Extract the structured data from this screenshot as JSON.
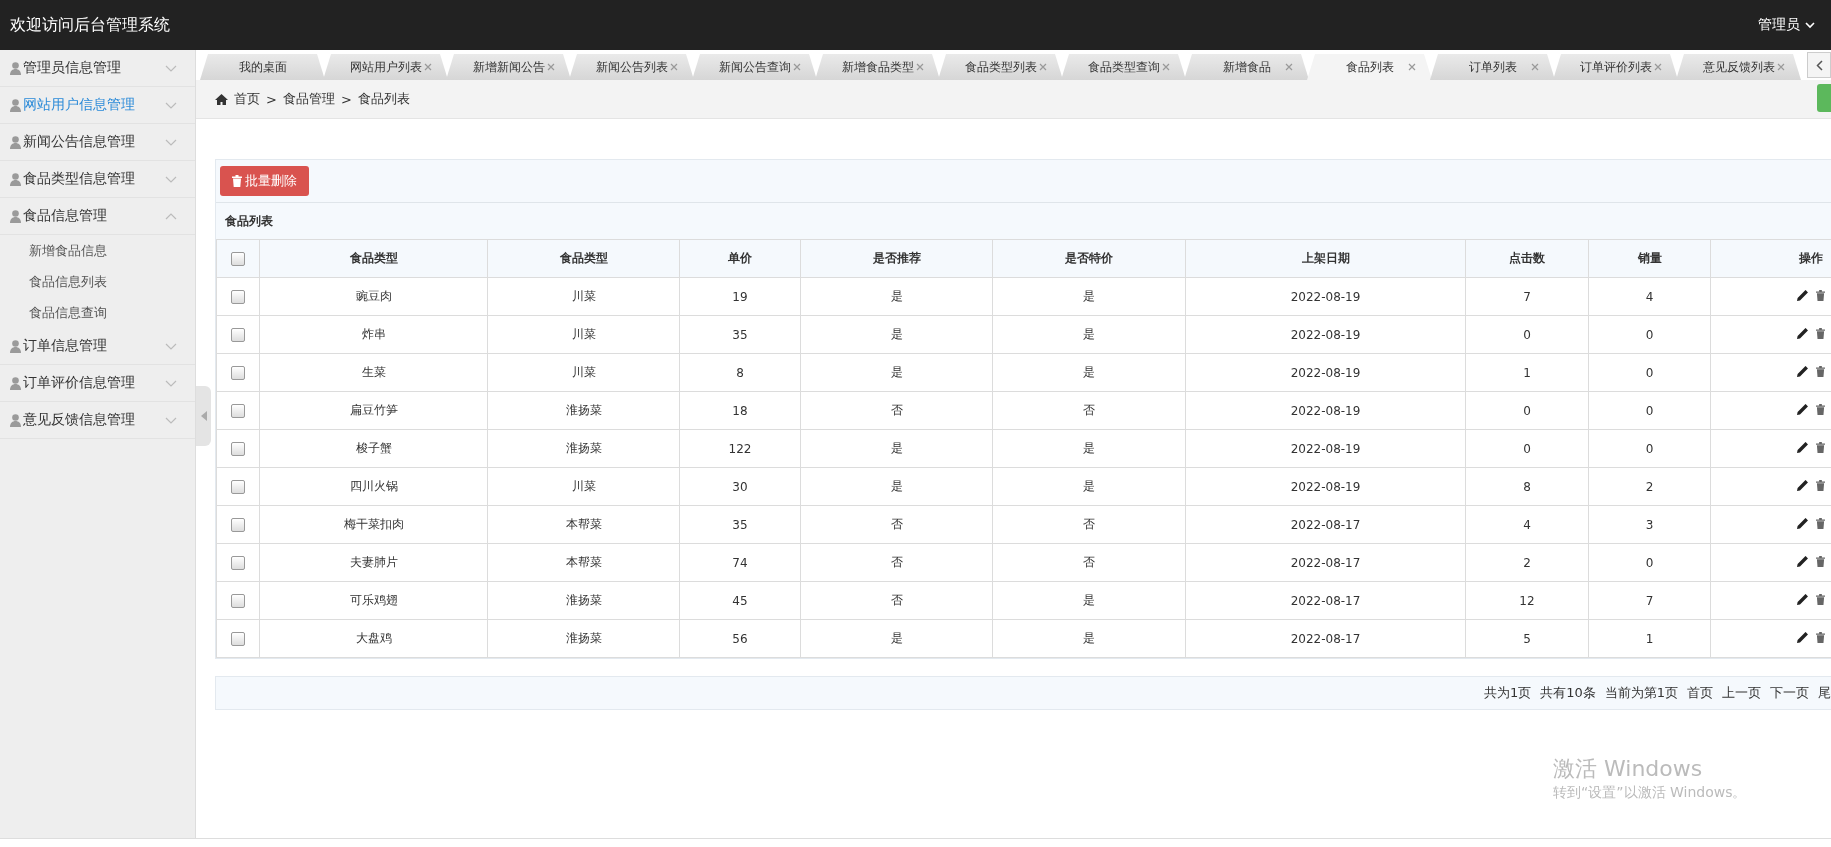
{
  "header": {
    "title": "欢迎访问后台管理系统",
    "user": "管理员"
  },
  "sidebar": {
    "items": [
      {
        "label": "管理员信息管理",
        "selected": false,
        "expanded": false
      },
      {
        "label": "网站用户信息管理",
        "selected": true,
        "expanded": false
      },
      {
        "label": "新闻公告信息管理",
        "selected": false,
        "expanded": false
      },
      {
        "label": "食品类型信息管理",
        "selected": false,
        "expanded": false
      },
      {
        "label": "食品信息管理",
        "selected": false,
        "expanded": true,
        "children": [
          {
            "label": "新增食品信息"
          },
          {
            "label": "食品信息列表"
          },
          {
            "label": "食品信息查询"
          }
        ]
      },
      {
        "label": "订单信息管理",
        "selected": false,
        "expanded": false
      },
      {
        "label": "订单评价信息管理",
        "selected": false,
        "expanded": false
      },
      {
        "label": "意见反馈信息管理",
        "selected": false,
        "expanded": false
      }
    ]
  },
  "tabs": [
    {
      "label": "我的桌面",
      "selected": false,
      "closable": false
    },
    {
      "label": "网站用户列表",
      "selected": false,
      "closable": true
    },
    {
      "label": "新增新闻公告",
      "selected": false,
      "closable": true
    },
    {
      "label": "新闻公告列表",
      "selected": false,
      "closable": true
    },
    {
      "label": "新闻公告查询",
      "selected": false,
      "closable": true
    },
    {
      "label": "新增食品类型",
      "selected": false,
      "closable": true
    },
    {
      "label": "食品类型列表",
      "selected": false,
      "closable": true
    },
    {
      "label": "食品类型查询",
      "selected": false,
      "closable": true
    },
    {
      "label": "新增食品",
      "selected": false,
      "closable": true
    },
    {
      "label": "食品列表",
      "selected": true,
      "closable": true
    },
    {
      "label": "订单列表",
      "selected": false,
      "closable": true
    },
    {
      "label": "订单评价列表",
      "selected": false,
      "closable": true
    },
    {
      "label": "意见反馈列表",
      "selected": false,
      "closable": true
    }
  ],
  "breadcrumb": [
    "首页",
    "食品管理",
    "食品列表"
  ],
  "breadcrumb_separator": ">",
  "batch_delete_button": "批量删除",
  "table": {
    "title": "食品列表",
    "select_all_checked": false,
    "columns": [
      "食品类型",
      "食品类型",
      "单价",
      "是否推荐",
      "是否特价",
      "上架日期",
      "点击数",
      "销量",
      "操作"
    ],
    "rows": [
      {
        "checked": false,
        "cells": [
          "豌豆肉",
          "川菜",
          "19",
          "是",
          "是",
          "2022-08-19",
          "7",
          "4"
        ]
      },
      {
        "checked": false,
        "cells": [
          "炸串",
          "川菜",
          "35",
          "是",
          "是",
          "2022-08-19",
          "0",
          "0"
        ]
      },
      {
        "checked": false,
        "cells": [
          "生菜",
          "川菜",
          "8",
          "是",
          "是",
          "2022-08-19",
          "1",
          "0"
        ]
      },
      {
        "checked": false,
        "cells": [
          "扁豆竹笋",
          "淮扬菜",
          "18",
          "否",
          "否",
          "2022-08-19",
          "0",
          "0"
        ]
      },
      {
        "checked": false,
        "cells": [
          "梭子蟹",
          "淮扬菜",
          "122",
          "是",
          "是",
          "2022-08-19",
          "0",
          "0"
        ]
      },
      {
        "checked": false,
        "cells": [
          "四川火锅",
          "川菜",
          "30",
          "是",
          "是",
          "2022-08-19",
          "8",
          "2"
        ]
      },
      {
        "checked": false,
        "cells": [
          "梅干菜扣肉",
          "本帮菜",
          "35",
          "否",
          "否",
          "2022-08-17",
          "4",
          "3"
        ]
      },
      {
        "checked": false,
        "cells": [
          "夫妻肺片",
          "本帮菜",
          "74",
          "否",
          "否",
          "2022-08-17",
          "2",
          "0"
        ]
      },
      {
        "checked": false,
        "cells": [
          "可乐鸡翅",
          "淮扬菜",
          "45",
          "否",
          "是",
          "2022-08-17",
          "12",
          "7"
        ]
      },
      {
        "checked": false,
        "cells": [
          "大盘鸡",
          "淮扬菜",
          "56",
          "是",
          "是",
          "2022-08-17",
          "5",
          "1"
        ]
      }
    ]
  },
  "pagination": [
    "共为1页",
    "共有10条",
    "当前为第1页",
    "首页",
    "上一页",
    "下一页",
    "尾"
  ],
  "activation_notice": {
    "title": "激活 Windows",
    "subtitle": "转到“设置”以激活 Windows。"
  }
}
